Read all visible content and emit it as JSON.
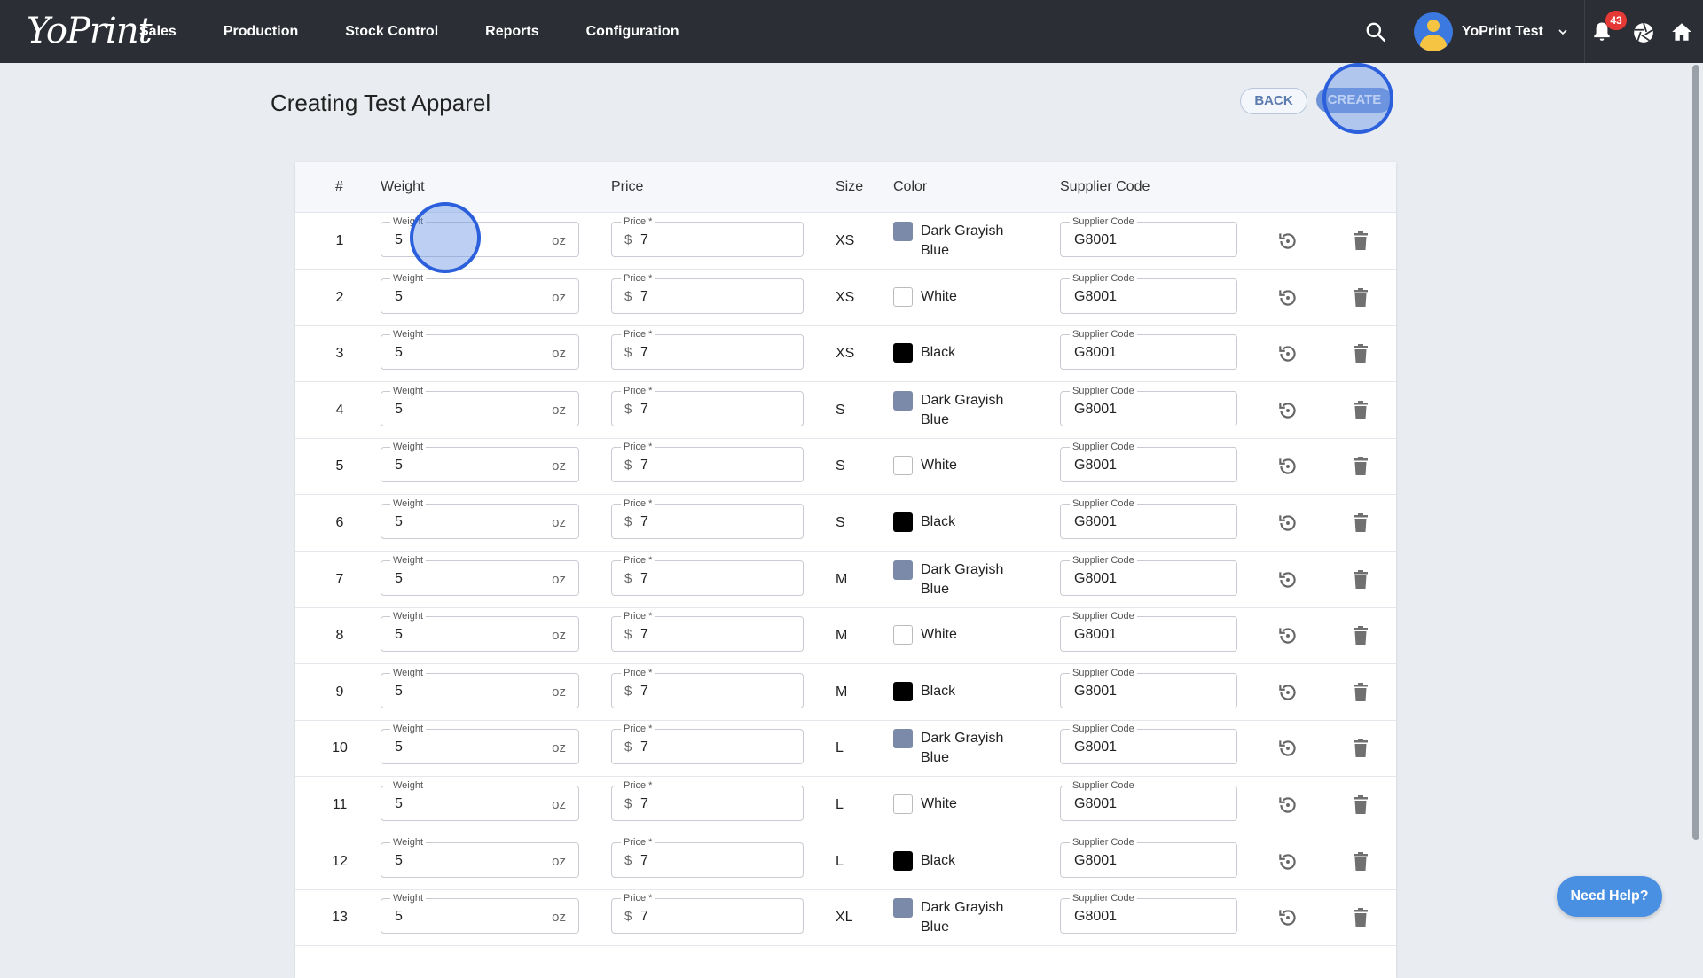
{
  "brand": {
    "logo_text": "YoPrint"
  },
  "nav": [
    {
      "label": "Sales"
    },
    {
      "label": "Production"
    },
    {
      "label": "Stock Control"
    },
    {
      "label": "Reports"
    },
    {
      "label": "Configuration"
    }
  ],
  "user": {
    "name": "YoPrint Test",
    "notifications": "43"
  },
  "page": {
    "title": "Creating Test Apparel",
    "back_label": "BACK",
    "create_label": "CREATE"
  },
  "table": {
    "headers": {
      "num": "#",
      "weight": "Weight",
      "price": "Price",
      "size": "Size",
      "color": "Color",
      "supplier": "Supplier Code"
    },
    "field_labels": {
      "weight": "Weight",
      "price": "Price *",
      "supplier": "Supplier Code"
    },
    "weight_unit": "oz",
    "currency": "$",
    "rows": [
      {
        "num": "1",
        "weight": "5",
        "price": "7",
        "size": "XS",
        "color": "Dark Grayish Blue",
        "swatch": "#7a8aa8",
        "supplier": "G8001"
      },
      {
        "num": "2",
        "weight": "5",
        "price": "7",
        "size": "XS",
        "color": "White",
        "swatch": "#ffffff",
        "supplier": "G8001"
      },
      {
        "num": "3",
        "weight": "5",
        "price": "7",
        "size": "XS",
        "color": "Black",
        "swatch": "#000000",
        "supplier": "G8001"
      },
      {
        "num": "4",
        "weight": "5",
        "price": "7",
        "size": "S",
        "color": "Dark Grayish Blue",
        "swatch": "#7a8aa8",
        "supplier": "G8001"
      },
      {
        "num": "5",
        "weight": "5",
        "price": "7",
        "size": "S",
        "color": "White",
        "swatch": "#ffffff",
        "supplier": "G8001"
      },
      {
        "num": "6",
        "weight": "5",
        "price": "7",
        "size": "S",
        "color": "Black",
        "swatch": "#000000",
        "supplier": "G8001"
      },
      {
        "num": "7",
        "weight": "5",
        "price": "7",
        "size": "M",
        "color": "Dark Grayish Blue",
        "swatch": "#7a8aa8",
        "supplier": "G8001"
      },
      {
        "num": "8",
        "weight": "5",
        "price": "7",
        "size": "M",
        "color": "White",
        "swatch": "#ffffff",
        "supplier": "G8001"
      },
      {
        "num": "9",
        "weight": "5",
        "price": "7",
        "size": "M",
        "color": "Black",
        "swatch": "#000000",
        "supplier": "G8001"
      },
      {
        "num": "10",
        "weight": "5",
        "price": "7",
        "size": "L",
        "color": "Dark Grayish Blue",
        "swatch": "#7a8aa8",
        "supplier": "G8001"
      },
      {
        "num": "11",
        "weight": "5",
        "price": "7",
        "size": "L",
        "color": "White",
        "swatch": "#ffffff",
        "supplier": "G8001"
      },
      {
        "num": "12",
        "weight": "5",
        "price": "7",
        "size": "L",
        "color": "Black",
        "swatch": "#000000",
        "supplier": "G8001"
      },
      {
        "num": "13",
        "weight": "5",
        "price": "7",
        "size": "XL",
        "color": "Dark Grayish Blue",
        "swatch": "#7a8aa8",
        "supplier": "G8001"
      }
    ]
  },
  "help": {
    "label": "Need Help?"
  },
  "colors": {
    "topbar": "#2b2e35",
    "accent": "#6e93d8",
    "help": "#4a90e2",
    "badge": "#e53935"
  }
}
